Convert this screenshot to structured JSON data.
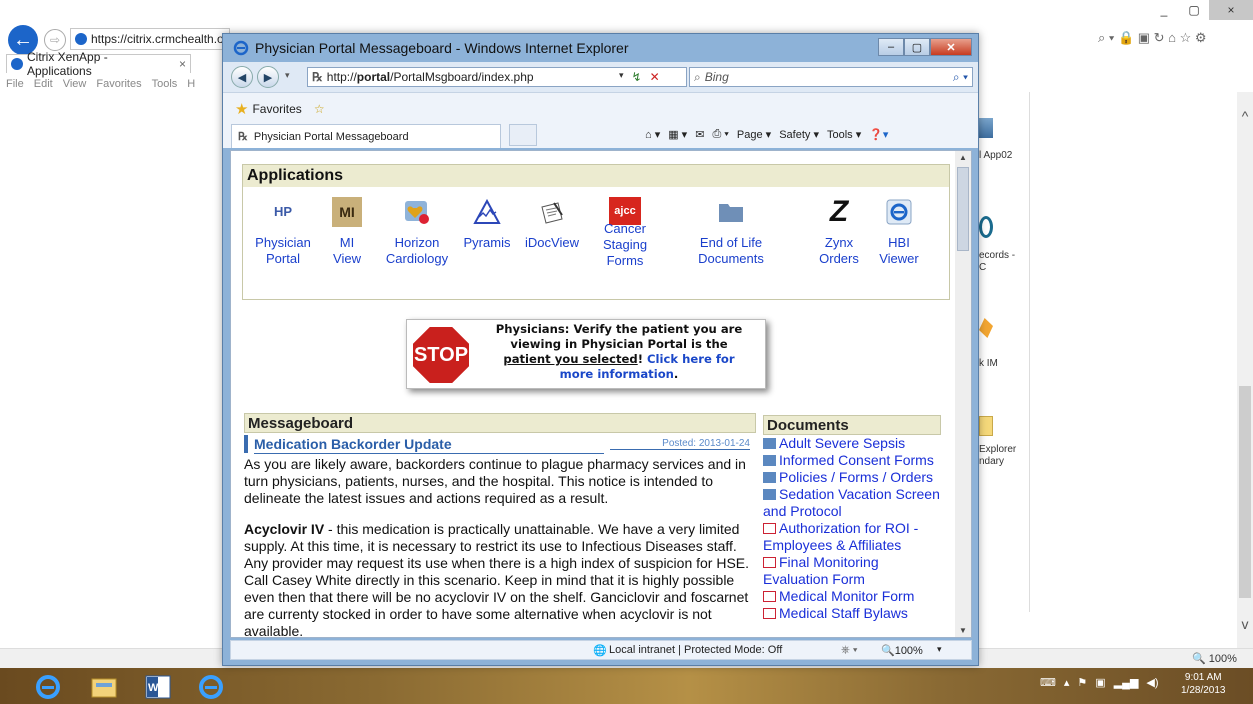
{
  "outer": {
    "url": "https://citrix.crmchealth.o",
    "tab_title": "Citrix XenApp - Applications",
    "tab_close": "×",
    "menu": [
      "File",
      "Edit",
      "View",
      "Favorites",
      "Tools",
      "H"
    ],
    "window_controls": [
      "_",
      "▢",
      "×"
    ],
    "toolbar_icons": [
      "search-icon",
      "lock-icon",
      "compat-icon",
      "refresh-icon",
      "home-icon",
      "star-icon",
      "gear-icon"
    ],
    "toolbar_glyphs": "⌕ ▾ 🔒 ▣ ↻   ⌂ ☆ ⚙",
    "zoom": "🔍 100%",
    "side_labels": [
      "l App02",
      "ecords -",
      "C",
      "k IM",
      "Explorer",
      "ndary"
    ]
  },
  "inner": {
    "window_title": "Physician Portal Messageboard - Windows Internet Explorer",
    "window_controls": [
      "–",
      "▢",
      "✕"
    ],
    "url_prefix": "http://",
    "url_host": "portal",
    "url_path": "/PortalMsgboard/index.php",
    "search_placeholder": "Bing",
    "favorites_label": "Favorites",
    "tab_title": "Physician Portal Messageboard",
    "command_bar": [
      "Page ▾",
      "Safety ▾",
      "Tools ▾"
    ],
    "status_text": "Local intranet | Protected Mode: Off",
    "status_zoom": "🔍100%"
  },
  "applications": {
    "heading": "Applications",
    "items": [
      {
        "line1": "Physician",
        "line2": "Portal",
        "line3": "",
        "icon": "hp-portal-icon"
      },
      {
        "line1": "MI",
        "line2": "View",
        "line3": "",
        "icon": "mi-view-icon"
      },
      {
        "line1": "Horizon",
        "line2": "Cardiology",
        "line3": "",
        "icon": "heart-icon"
      },
      {
        "line1": "Pyramis",
        "line2": "",
        "line3": "",
        "icon": "pyramid-icon"
      },
      {
        "line1": "iDocView",
        "line2": "",
        "line3": "",
        "icon": "document-pen-icon"
      },
      {
        "line1": "Cancer",
        "line2": "Staging",
        "line3": "Forms",
        "icon": "ajcc-icon"
      },
      {
        "line1": "End of Life",
        "line2": "Documents",
        "line3": "",
        "icon": "folder-icon"
      },
      {
        "line1": "Zynx",
        "line2": "Orders",
        "line3": "",
        "icon": "zynx-icon"
      },
      {
        "line1": "HBI",
        "line2": "Viewer",
        "line3": "",
        "icon": "ie-icon"
      }
    ],
    "icon_text": {
      "hp": "HP",
      "mi": "MI",
      "ajcc": "ajcc",
      "z": "Z",
      "e": "e"
    }
  },
  "notice": {
    "stop": "STOP",
    "line1": "Physicians: Verify the patient you are",
    "line2": "viewing in Physician Portal is the",
    "underlined": "patient you selected",
    "bang": "! ",
    "link1": "Click here for",
    "link2": "more information",
    "period": "."
  },
  "messageboard": {
    "heading": "Messageboard",
    "title": "Medication Backorder Update",
    "posted": "Posted: 2013-01-24",
    "para1": "As you are likely aware, backorders continue to plague pharmacy services and in turn physicians, patients, nurses, and the hospital. This notice is intended to delineate the latest issues and actions required as a result.",
    "para2_bold": "Acyclovir IV",
    "para2": " - this medication is practically unattainable. We have a very limited supply. At this time, it is necessary to restrict its use to Infectious Diseases staff. Any provider may request its use when there is a high index of suspicion for HSE. Call Casey White directly in this scenario. Keep in mind that it is highly possible even then that there will be no acyclovir IV on the shelf. Ganciclovir and foscarnet are currenty stocked in order to have some alternative when acyclovir is not available."
  },
  "documents": {
    "heading": "Documents",
    "items": [
      {
        "label": "Adult Severe Sepsis",
        "type": "folder"
      },
      {
        "label": "Informed Consent Forms",
        "type": "folder"
      },
      {
        "label": "Policies / Forms / Orders",
        "type": "folder"
      },
      {
        "label": "Sedation Vacation Screen and Protocol",
        "type": "folder"
      },
      {
        "label": "Authorization for ROI - Employees & Affiliates",
        "type": "pdf"
      },
      {
        "label": "Final Monitoring Evaluation Form",
        "type": "pdf"
      },
      {
        "label": "Medical Monitor Form",
        "type": "pdf"
      },
      {
        "label": "Medical Staff Bylaws",
        "type": "pdf"
      }
    ]
  },
  "taskbar": {
    "clock_time": "9:01 AM",
    "clock_date": "1/28/2013"
  },
  "colors": {
    "ie_blue": "#1c65c9",
    "link_blue": "#1a3fcc",
    "stop_red": "#c9201d",
    "panel_tan": "#ecebd0"
  }
}
